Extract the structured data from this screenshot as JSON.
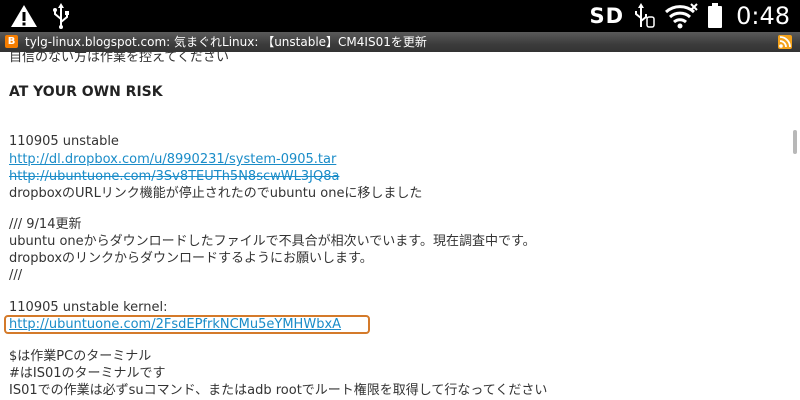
{
  "status_bar": {
    "sd_label": "SD",
    "clock": "0:48",
    "icons": [
      "warning-icon",
      "usb-icon",
      "sd-card-icon",
      "usb-debug-icon",
      "wifi-icon",
      "battery-icon"
    ]
  },
  "browser": {
    "page_title": "tylg-linux.blogspot.com: 気まぐれLinux: 【unstable】CM4IS01を更新",
    "favicon": "B"
  },
  "content": {
    "line_top": "自信のない方は作業を控えてください",
    "risk_heading": "AT YOUR OWN RISK",
    "release_1": "110905 unstable",
    "link_dropbox": "http://dl.dropbox.com/u/8990231/system-0905.tar",
    "link_ubuntuone_old": "http://ubuntuone.com/3Sv8TEUTh5N8scwWL3JQ8a",
    "dropbox_note": "dropboxのURLリンク機能が停止されたのでubuntu oneに移しました",
    "update_header": "/// 9/14更新",
    "update_line1": "ubuntu oneからダウンロードしたファイルで不具合が相次いでいます。現在調査中です。",
    "update_line2": "dropboxのリンクからダウンロードするようにお願いします。",
    "update_footer": "///",
    "release_2": "110905 unstable kernel:",
    "link_kernel": "http://ubuntuone.com/2FsdEPfrkNCMu5eYMHWbxA",
    "note_pc": "$は作業PCのターミナル",
    "note_is01": "#はIS01のターミナルです",
    "note_root": "IS01での作業は必ずsuコマンド、またはadb rootでルート権限を取得して行なってください"
  }
}
